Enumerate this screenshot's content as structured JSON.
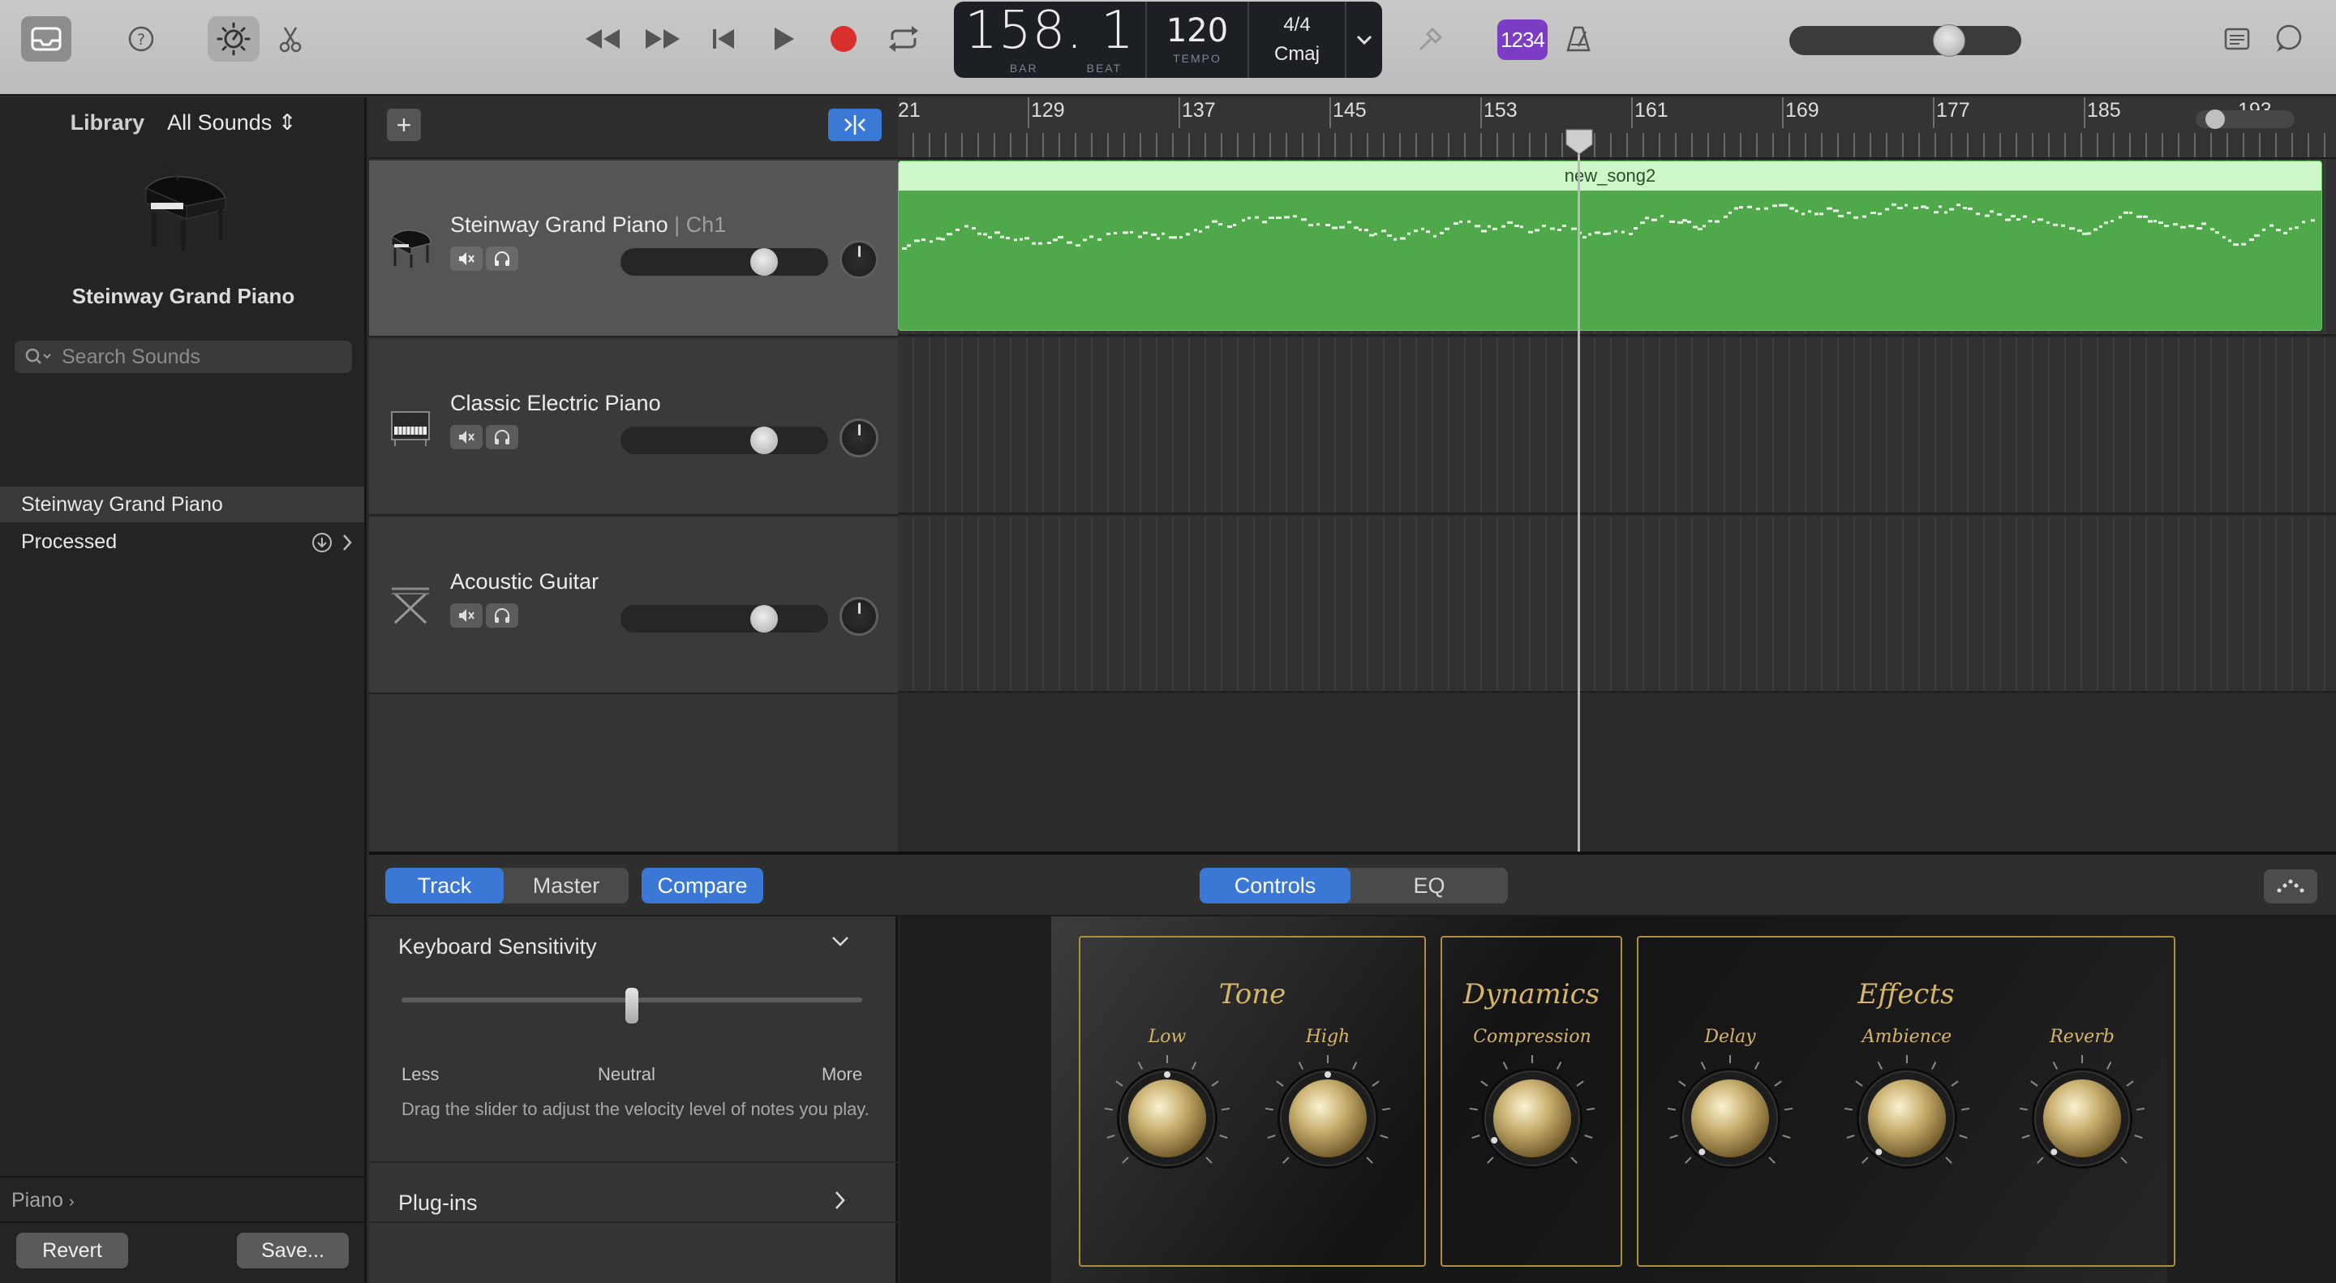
{
  "toolbar": {
    "lcd": {
      "position": "158. 1",
      "bar_label": "BAR",
      "beat_label": "BEAT",
      "tempo": "120",
      "tempo_label": "TEMPO",
      "time_signature": "4/4",
      "key": "Cmaj"
    },
    "count_in_badge": "1234",
    "master_volume_fraction": 0.72
  },
  "library": {
    "title": "Library",
    "filter": "All Sounds",
    "selected_instrument": "Steinway Grand Piano",
    "search_placeholder": "Search Sounds",
    "items": [
      {
        "label": "Steinway Grand Piano"
      },
      {
        "label": "Processed"
      }
    ],
    "path": "Piano",
    "revert_label": "Revert",
    "save_label": "Save..."
  },
  "tracks": [
    {
      "name": "Steinway Grand Piano",
      "channel": "| Ch1",
      "selected": true
    },
    {
      "name": "Classic Electric Piano",
      "channel": "",
      "selected": false
    },
    {
      "name": "Acoustic Guitar",
      "channel": "",
      "selected": false
    }
  ],
  "ruler": {
    "bars": [
      "21",
      "129",
      "137",
      "145",
      "153",
      "161",
      "169",
      "177",
      "185",
      "193"
    ]
  },
  "region": {
    "name": "new_song2",
    "color": "#4fa94a"
  },
  "editor": {
    "tabs": [
      "Track",
      "Master"
    ],
    "active_tab": "Track",
    "compare_label": "Compare",
    "view_tabs": [
      "Controls",
      "EQ"
    ],
    "active_view": "Controls",
    "keyboard_sensitivity": {
      "title": "Keyboard Sensitivity",
      "less": "Less",
      "neutral": "Neutral",
      "more": "More",
      "value_fraction": 0.5,
      "description": "Drag the slider to adjust the velocity level of notes you play."
    },
    "plugins_label": "Plug-ins",
    "panel": {
      "tone": {
        "title": "Tone",
        "knobs": [
          "Low",
          "High"
        ]
      },
      "dynamics": {
        "title": "Dynamics",
        "knobs": [
          "Compression"
        ]
      },
      "effects": {
        "title": "Effects",
        "knobs": [
          "Delay",
          "Ambience",
          "Reverb"
        ]
      }
    }
  },
  "colors": {
    "accent": "#3b77d4",
    "region_header": "#cdf7c9",
    "gold": "#d6b56a",
    "record": "#d9302c",
    "badge": "#7c3cc4"
  }
}
